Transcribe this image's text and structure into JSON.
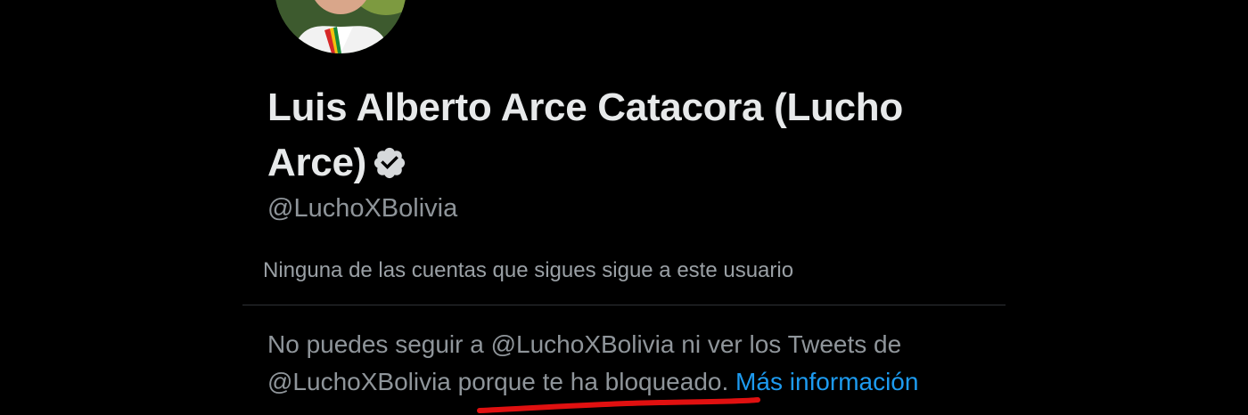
{
  "profile": {
    "display_name": "Luis Alberto Arce Catacora (Lucho Arce)",
    "handle": "@LuchoXBolivia",
    "verified_icon": "verified-badge-icon",
    "followers_note": "Ninguna de las cuentas que sigues sigue a este usuario"
  },
  "blocked": {
    "text_part1": "No puedes seguir a @LuchoXBolivia ni ver los Tweets de @LuchoXBolivia ",
    "text_emphasis": "porque te ha bloqueado",
    "text_period": ". ",
    "link_label": "Más información"
  },
  "colors": {
    "background": "#000000",
    "primary_text": "#e7e9ea",
    "secondary_text": "#8f959a",
    "link": "#1d9bf0",
    "annotation": "#e01010"
  }
}
